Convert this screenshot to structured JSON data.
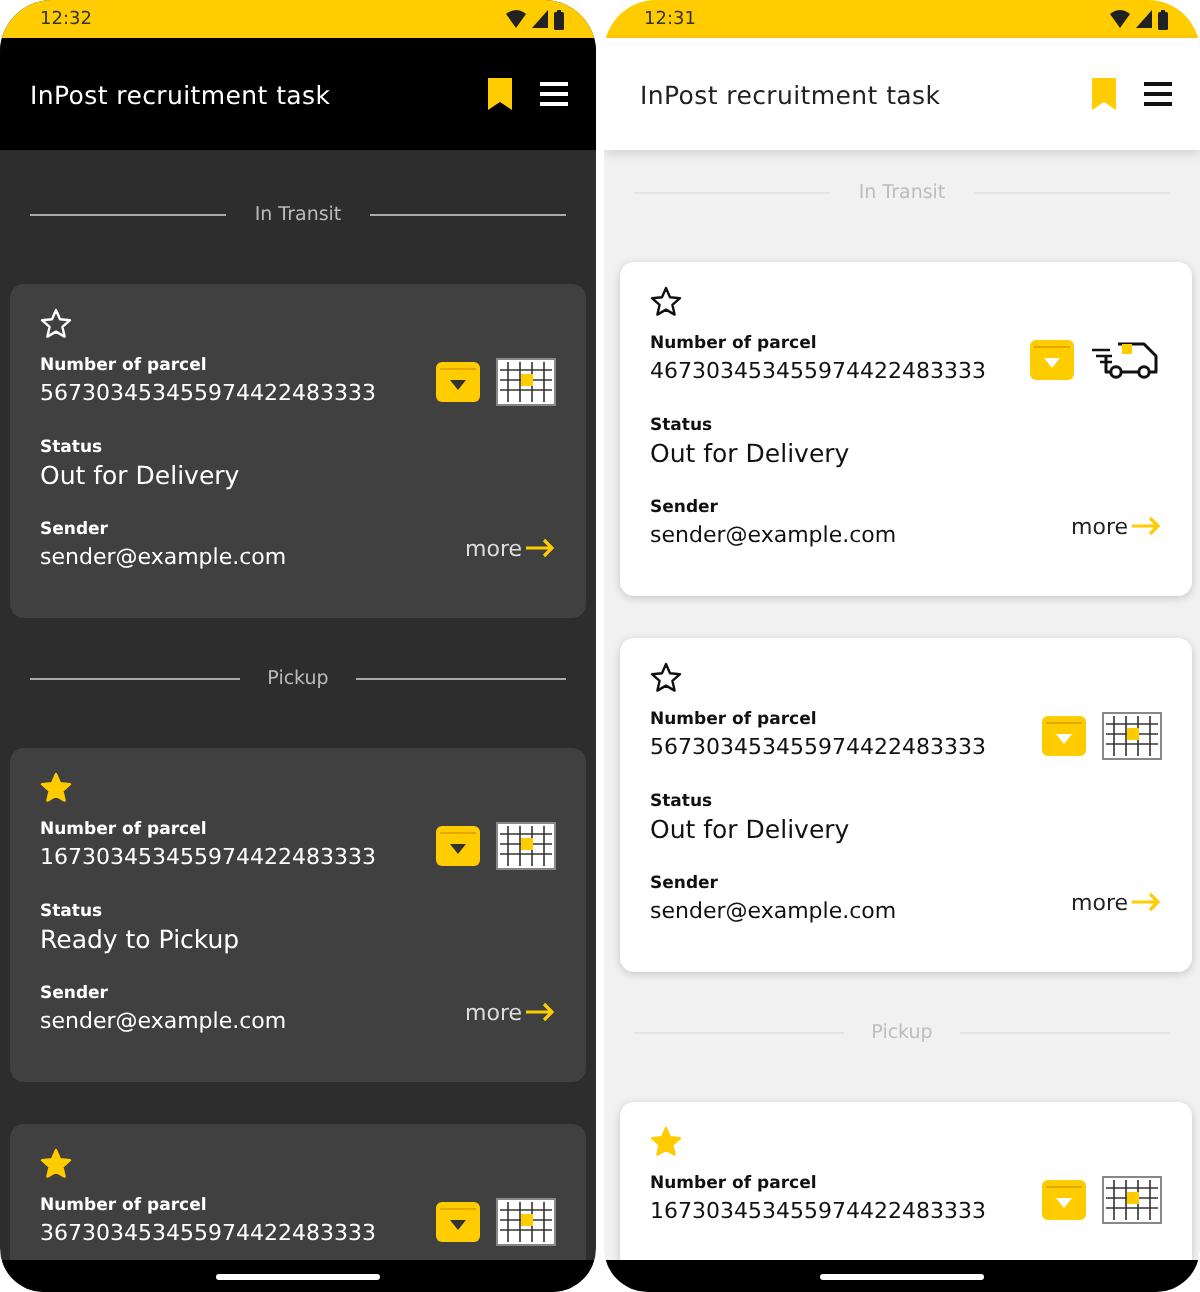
{
  "phones": [
    {
      "kind": "dark",
      "time": "12:32",
      "app_title": "InPost recruitment task",
      "sections": [
        {
          "title": "In Transit",
          "parcels": [
            {
              "starred": false,
              "kind": "locker",
              "number_label": "Number of parcel",
              "number": "567303453455974422483333",
              "status_label": "Status",
              "status": "Out for Delivery",
              "sender_label": "Sender",
              "sender": "sender@example.com",
              "more": "more"
            }
          ]
        },
        {
          "title": "Pickup",
          "parcels": [
            {
              "starred": true,
              "kind": "locker",
              "number_label": "Number of parcel",
              "number": "167303453455974422483333",
              "status_label": "Status",
              "status": "Ready to Pickup",
              "sender_label": "Sender",
              "sender": "sender@example.com",
              "more": "more"
            },
            {
              "starred": true,
              "kind": "locker",
              "number_label": "Number of parcel",
              "number": "367303453455974422483333"
            }
          ]
        }
      ]
    },
    {
      "kind": "light",
      "time": "12:31",
      "app_title": "InPost recruitment task",
      "sections": [
        {
          "title": "In Transit",
          "parcels": [
            {
              "starred": false,
              "kind": "courier",
              "number_label": "Number of parcel",
              "number": "467303453455974422483333",
              "status_label": "Status",
              "status": "Out for Delivery",
              "sender_label": "Sender",
              "sender": "sender@example.com",
              "more": "more"
            },
            {
              "starred": false,
              "kind": "locker",
              "number_label": "Number of parcel",
              "number": "567303453455974422483333",
              "status_label": "Status",
              "status": "Out for Delivery",
              "sender_label": "Sender",
              "sender": "sender@example.com",
              "more": "more"
            }
          ]
        },
        {
          "title": "Pickup",
          "parcels": [
            {
              "starred": true,
              "kind": "locker",
              "number_label": "Number of parcel",
              "number": "167303453455974422483333"
            }
          ]
        }
      ]
    }
  ]
}
